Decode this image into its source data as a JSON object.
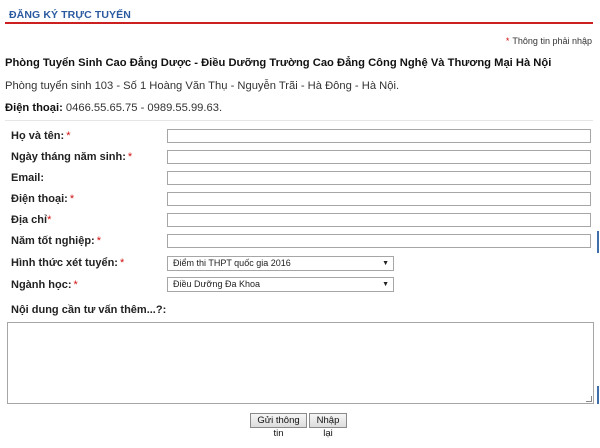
{
  "header": {
    "title": "ĐĂNG KÝ TRỰC TUYẾN"
  },
  "required_note": {
    "star": "*",
    "text": "Thông tin phải nhập"
  },
  "info": {
    "name": "Phòng Tuyển Sinh Cao Đẳng Dược - Điều Dưỡng Trường Cao Đẳng Công Nghệ Và Thương Mại Hà Nội",
    "address": "Phòng tuyển sinh 103 - Số 1 Hoàng Văn Thụ - Nguyễn Trãi - Hà Đông - Hà Nội.",
    "phone_label": "Điện thoại:",
    "phone_value": " 0466.55.65.75 - 0989.55.99.63."
  },
  "form": {
    "fullname": {
      "label": "Họ và tên:",
      "star": "*",
      "value": ""
    },
    "birthdate": {
      "label": "Ngày tháng năm sinh:",
      "star": "*",
      "value": ""
    },
    "email": {
      "label": "Email:",
      "value": ""
    },
    "phone": {
      "label": "Điện thoại:",
      "star": "*",
      "value": ""
    },
    "address": {
      "label": "Địa chỉ",
      "star": "*",
      "value": ""
    },
    "grad_year": {
      "label": "Năm tốt nghiệp:",
      "star": "*",
      "value": ""
    },
    "admission_method": {
      "label": "Hình thức xét tuyển:",
      "star": "*",
      "selected": "Điểm thi THPT quốc gia 2016"
    },
    "major": {
      "label": "Ngành học:",
      "star": "*",
      "selected": "Điều Dưỡng Đa Khoa"
    },
    "message": {
      "label": "Nội dung cần tư vấn thêm...?:",
      "value": ""
    }
  },
  "buttons": {
    "submit": "Gửi thông tin",
    "reset": "Nhập lại"
  },
  "icons": {
    "dropdown": "chevron-down-icon",
    "resize": "resize-grip-icon"
  },
  "colors": {
    "accent_red": "#cc1f1f",
    "title_blue": "#2a5aa0",
    "required_star": "#d01010"
  }
}
